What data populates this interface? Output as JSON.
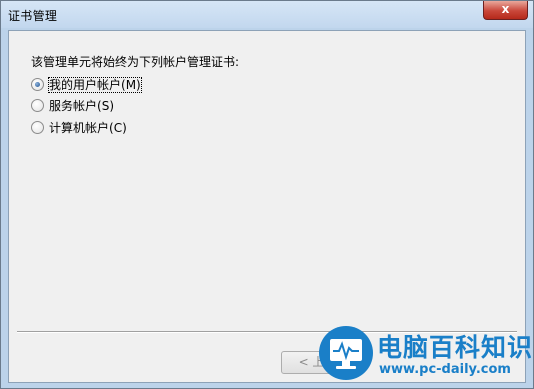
{
  "window": {
    "title": "证书管理",
    "close_label": "x"
  },
  "dialog": {
    "prompt": "该管理单元将始终为下列帐户管理证书:",
    "options": [
      {
        "label": "我的用户帐户",
        "accel": "(M)",
        "checked": true
      },
      {
        "label": "服务帐户",
        "accel": "(S)",
        "checked": false
      },
      {
        "label": "计算机帐户",
        "accel": "(C)",
        "checked": false
      }
    ],
    "buttons": {
      "back_label": "< 上一"
    }
  },
  "watermark": {
    "title": "电脑百科知识",
    "url": "www.pc-daily.com"
  },
  "colors": {
    "accent": "#1a7fc8",
    "close": "#c9473a",
    "client_bg": "#f0f0f0",
    "frame": "#bcd3ea"
  }
}
